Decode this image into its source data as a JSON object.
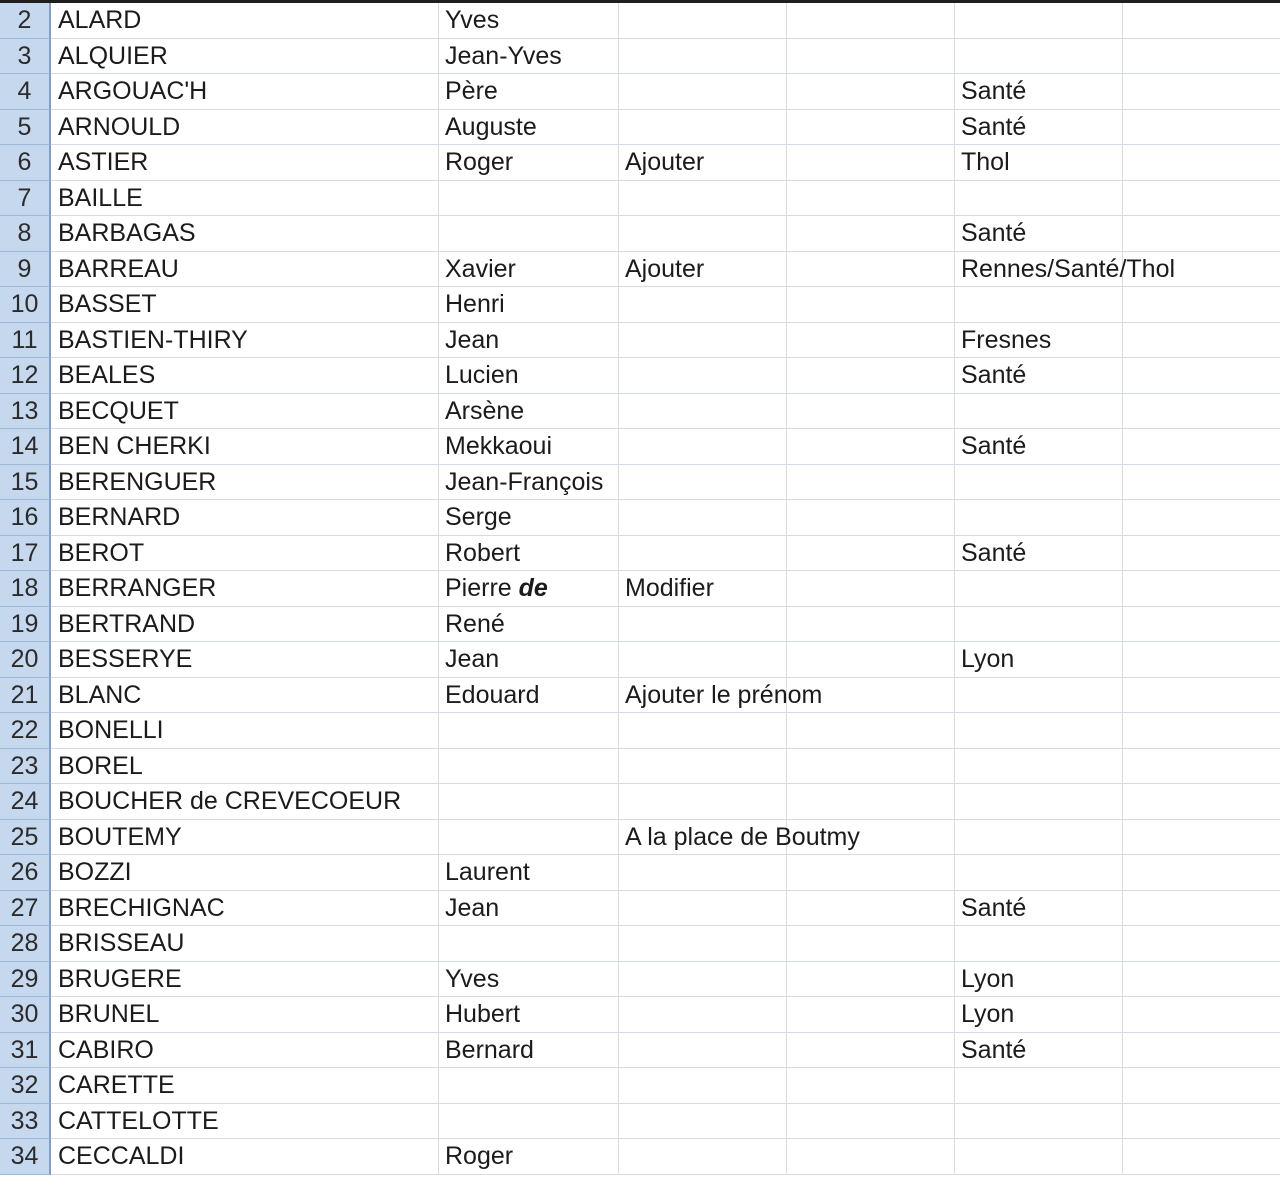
{
  "rows": [
    {
      "num": "2",
      "a": "ALARD",
      "b": "Yves",
      "c": "",
      "e": ""
    },
    {
      "num": "3",
      "a": "ALQUIER",
      "b": "Jean-Yves",
      "c": "",
      "e": ""
    },
    {
      "num": "4",
      "a": "ARGOUAC'H",
      "b": "Père",
      "c": "",
      "e": "Santé"
    },
    {
      "num": "5",
      "a": "ARNOULD",
      "b": "Auguste",
      "c": "",
      "e": "Santé"
    },
    {
      "num": "6",
      "a": "ASTIER",
      "b": "Roger",
      "c": "Ajouter",
      "e": "Thol"
    },
    {
      "num": "7",
      "a": "BAILLE",
      "b": "",
      "c": "",
      "e": ""
    },
    {
      "num": "8",
      "a": "BARBAGAS",
      "b": "",
      "c": "",
      "e": "Santé"
    },
    {
      "num": "9",
      "a": "BARREAU",
      "b": "Xavier",
      "c": "Ajouter",
      "e": "Rennes/Santé/Thol"
    },
    {
      "num": "10",
      "a": "BASSET",
      "b": "Henri",
      "c": "",
      "e": ""
    },
    {
      "num": "11",
      "a": "BASTIEN-THIRY",
      "b": "Jean",
      "c": "",
      "e": "Fresnes"
    },
    {
      "num": "12",
      "a": "BEALES",
      "b": "Lucien",
      "c": "",
      "e": "Santé"
    },
    {
      "num": "13",
      "a": "BECQUET",
      "b": "Arsène",
      "c": "",
      "e": ""
    },
    {
      "num": "14",
      "a": "BEN CHERKI",
      "b": "Mekkaoui",
      "c": "",
      "e": "Santé"
    },
    {
      "num": "15",
      "a": "BERENGUER",
      "b": "Jean-François",
      "c": "",
      "e": ""
    },
    {
      "num": "16",
      "a": "BERNARD",
      "b": "Serge",
      "c": "",
      "e": ""
    },
    {
      "num": "17",
      "a": "BEROT",
      "b": "Robert",
      "c": "",
      "e": "Santé"
    },
    {
      "num": "18",
      "a": "BERRANGER",
      "b": "Pierre",
      "b_particle": "de",
      "c": "Modifier",
      "e": ""
    },
    {
      "num": "19",
      "a": "BERTRAND",
      "b": "René",
      "c": "",
      "e": ""
    },
    {
      "num": "20",
      "a": "BESSERYE",
      "b": "Jean",
      "c": "",
      "e": "Lyon"
    },
    {
      "num": "21",
      "a": "BLANC",
      "b": "Edouard",
      "c": "Ajouter le prénom",
      "e": ""
    },
    {
      "num": "22",
      "a": "BONELLI",
      "b": "",
      "c": "",
      "e": ""
    },
    {
      "num": "23",
      "a": "BOREL",
      "b": "",
      "c": "",
      "e": ""
    },
    {
      "num": "24",
      "a": "BOUCHER de CREVECOEUR",
      "b": "",
      "c": "",
      "e": ""
    },
    {
      "num": "25",
      "a": "BOUTEMY",
      "b": "",
      "c": "A la place de Boutmy",
      "e": ""
    },
    {
      "num": "26",
      "a": "BOZZI",
      "b": "Laurent",
      "c": "",
      "e": ""
    },
    {
      "num": "27",
      "a": "BRECHIGNAC",
      "b": "Jean",
      "c": "",
      "e": "Santé"
    },
    {
      "num": "28",
      "a": "BRISSEAU",
      "b": "",
      "c": "",
      "e": ""
    },
    {
      "num": "29",
      "a": "BRUGERE",
      "b": "Yves",
      "c": "",
      "e": "Lyon"
    },
    {
      "num": "30",
      "a": "BRUNEL",
      "b": "Hubert",
      "c": "",
      "e": "Lyon"
    },
    {
      "num": "31",
      "a": "CABIRO",
      "b": "Bernard",
      "c": "",
      "e": "Santé"
    },
    {
      "num": "32",
      "a": "CARETTE",
      "b": "",
      "c": "",
      "e": ""
    },
    {
      "num": "33",
      "a": "CATTELOTTE",
      "b": "",
      "c": "",
      "e": ""
    },
    {
      "num": "34",
      "a": "CECCALDI",
      "b": "Roger",
      "c": "",
      "e": ""
    }
  ]
}
